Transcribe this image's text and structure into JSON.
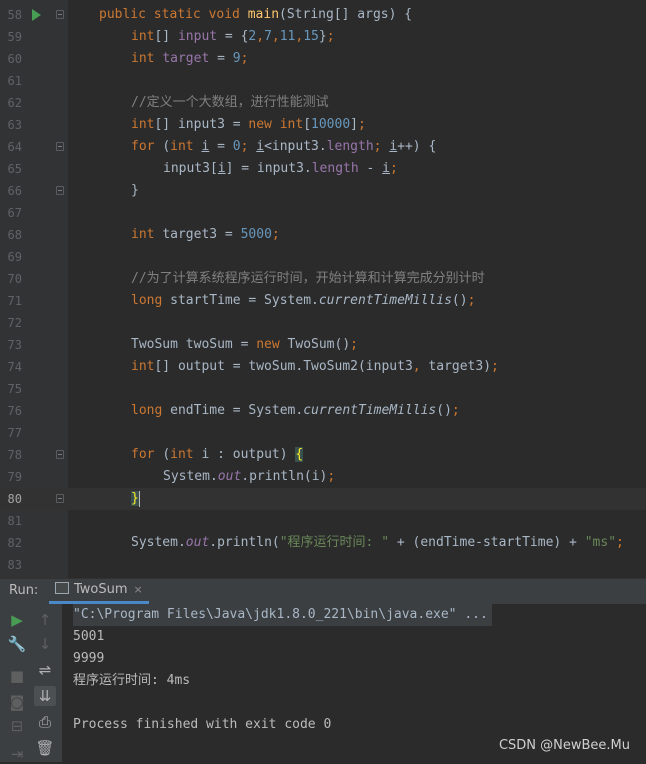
{
  "editor": {
    "current_line": "80",
    "lines": [
      {
        "num": "58",
        "fold": true,
        "run": true,
        "indent": 0,
        "tokens": [
          [
            "kw",
            "public static void "
          ],
          [
            "fn",
            "main"
          ],
          [
            "",
            "(String[] args) {"
          ]
        ]
      },
      {
        "num": "59",
        "fold": false,
        "indent": 1,
        "tokens": [
          [
            "kw",
            "int"
          ],
          [
            "",
            "[] "
          ],
          [
            "field",
            "input"
          ],
          [
            "",
            " = {"
          ],
          [
            "num",
            "2"
          ],
          [
            "kw",
            ","
          ],
          [
            "num",
            "7"
          ],
          [
            "kw",
            ","
          ],
          [
            "num",
            "11"
          ],
          [
            "kw",
            ","
          ],
          [
            "num",
            "15"
          ],
          [
            "",
            "}"
          ],
          [
            "kw",
            ";"
          ]
        ]
      },
      {
        "num": "60",
        "fold": false,
        "indent": 1,
        "tokens": [
          [
            "kw",
            "int "
          ],
          [
            "field",
            "target"
          ],
          [
            "",
            " = "
          ],
          [
            "num",
            "9"
          ],
          [
            "kw",
            ";"
          ]
        ]
      },
      {
        "num": "61",
        "fold": false,
        "indent": 0,
        "tokens": []
      },
      {
        "num": "62",
        "fold": false,
        "indent": 1,
        "tokens": [
          [
            "cmt",
            "//定义一个大数组，进行性能测试"
          ]
        ]
      },
      {
        "num": "63",
        "fold": false,
        "indent": 1,
        "tokens": [
          [
            "kw",
            "int"
          ],
          [
            "",
            "[] input3 = "
          ],
          [
            "kw",
            "new int"
          ],
          [
            "",
            "["
          ],
          [
            "num",
            "10000"
          ],
          [
            "",
            "]"
          ],
          [
            "kw",
            ";"
          ]
        ]
      },
      {
        "num": "64",
        "fold": true,
        "indent": 1,
        "tokens": [
          [
            "kw",
            "for "
          ],
          [
            "",
            "("
          ],
          [
            "kw",
            "int "
          ],
          [
            "ul",
            "i"
          ],
          [
            "",
            " = "
          ],
          [
            "num",
            "0"
          ],
          [
            "kw",
            "; "
          ],
          [
            "ul",
            "i"
          ],
          [
            "",
            "<input3."
          ],
          [
            "field",
            "length"
          ],
          [
            "kw",
            "; "
          ],
          [
            "ul",
            "i"
          ],
          [
            "",
            "++) {"
          ]
        ]
      },
      {
        "num": "65",
        "fold": false,
        "indent": 2,
        "tokens": [
          [
            "",
            "input3["
          ],
          [
            "ul",
            "i"
          ],
          [
            "",
            "] = input3."
          ],
          [
            "field",
            "length"
          ],
          [
            "",
            " - "
          ],
          [
            "ul",
            "i"
          ],
          [
            "kw",
            ";"
          ]
        ]
      },
      {
        "num": "66",
        "fold": true,
        "indent": 1,
        "tokens": [
          [
            "",
            "}"
          ]
        ]
      },
      {
        "num": "67",
        "fold": false,
        "indent": 0,
        "tokens": []
      },
      {
        "num": "68",
        "fold": false,
        "indent": 1,
        "tokens": [
          [
            "kw",
            "int "
          ],
          [
            "",
            "target3 = "
          ],
          [
            "num",
            "5000"
          ],
          [
            "kw",
            ";"
          ]
        ]
      },
      {
        "num": "69",
        "fold": false,
        "indent": 0,
        "tokens": []
      },
      {
        "num": "70",
        "fold": false,
        "indent": 1,
        "tokens": [
          [
            "cmt",
            "//为了计算系统程序运行时间，开始计算和计算完成分别计时"
          ]
        ]
      },
      {
        "num": "71",
        "fold": false,
        "indent": 1,
        "tokens": [
          [
            "kw",
            "long "
          ],
          [
            "",
            "startTime = System."
          ],
          [
            "it",
            "currentTimeMillis"
          ],
          [
            "",
            "()"
          ],
          [
            "kw",
            ";"
          ]
        ]
      },
      {
        "num": "72",
        "fold": false,
        "indent": 0,
        "tokens": []
      },
      {
        "num": "73",
        "fold": false,
        "indent": 1,
        "tokens": [
          [
            "",
            "TwoSum twoSum = "
          ],
          [
            "kw",
            "new "
          ],
          [
            "",
            "TwoSum()"
          ],
          [
            "kw",
            ";"
          ]
        ]
      },
      {
        "num": "74",
        "fold": false,
        "indent": 1,
        "tokens": [
          [
            "kw",
            "int"
          ],
          [
            "",
            "[] output = twoSum.TwoSum2(input3"
          ],
          [
            "kw",
            ", "
          ],
          [
            "",
            "target3)"
          ],
          [
            "kw",
            ";"
          ]
        ]
      },
      {
        "num": "75",
        "fold": false,
        "indent": 0,
        "tokens": []
      },
      {
        "num": "76",
        "fold": false,
        "indent": 1,
        "tokens": [
          [
            "kw",
            "long "
          ],
          [
            "",
            "endTime = System."
          ],
          [
            "it",
            "currentTimeMillis"
          ],
          [
            "",
            "()"
          ],
          [
            "kw",
            ";"
          ]
        ]
      },
      {
        "num": "77",
        "fold": false,
        "indent": 0,
        "tokens": []
      },
      {
        "num": "78",
        "fold": true,
        "indent": 1,
        "tokens": [
          [
            "kw",
            "for "
          ],
          [
            "",
            "("
          ],
          [
            "kw",
            "int "
          ],
          [
            "",
            "i : output) "
          ],
          [
            "bracehl",
            "{"
          ]
        ]
      },
      {
        "num": "79",
        "fold": false,
        "indent": 2,
        "tokens": [
          [
            "",
            "System."
          ],
          [
            "sfield",
            "out"
          ],
          [
            "",
            ".println(i)"
          ],
          [
            "kw",
            ";"
          ]
        ]
      },
      {
        "num": "80",
        "fold": true,
        "indent": 1,
        "tokens": [
          [
            "bracehl",
            "}"
          ],
          [
            "caret",
            ""
          ]
        ]
      },
      {
        "num": "81",
        "fold": false,
        "indent": 0,
        "tokens": []
      },
      {
        "num": "82",
        "fold": false,
        "indent": 1,
        "tokens": [
          [
            "",
            "System."
          ],
          [
            "sfield",
            "out"
          ],
          [
            "",
            ".println("
          ],
          [
            "str",
            "\"程序运行时间: \""
          ],
          [
            "",
            " + (endTime-startTime) + "
          ],
          [
            "str",
            "\"ms\""
          ],
          [
            ")"
          ],
          [
            "kw",
            ";"
          ]
        ]
      },
      {
        "num": "83",
        "fold": false,
        "indent": 0,
        "tokens": []
      }
    ]
  },
  "run_panel": {
    "label": "Run:",
    "tab_label": "TwoSum",
    "tab_close": "×",
    "toolbar": [
      {
        "name": "rerun-icon",
        "glyph": "▶",
        "style": "green"
      },
      {
        "name": "scroll-up-icon",
        "glyph": "↑",
        "style": "dim"
      },
      {
        "name": "wrench-icon",
        "glyph": "🔧",
        "style": ""
      },
      {
        "name": "scroll-down-icon",
        "glyph": "↓",
        "style": "dim"
      },
      {
        "name": "stop-icon",
        "glyph": "■",
        "style": "dim"
      },
      {
        "name": "soft-wrap-icon",
        "glyph": "⇌",
        "style": ""
      },
      {
        "name": "camera-icon",
        "glyph": "◙",
        "style": "dim"
      },
      {
        "name": "scroll-to-end-icon",
        "glyph": "⇊",
        "style": "sel"
      },
      {
        "name": "restore-layout-icon",
        "glyph": "⊟",
        "style": "dim"
      },
      {
        "name": "print-icon",
        "glyph": "⎙",
        "style": ""
      },
      {
        "name": "exit-icon",
        "glyph": "⇥",
        "style": "dim"
      },
      {
        "name": "trash-icon",
        "glyph": "🗑",
        "style": ""
      }
    ],
    "console_lines": [
      {
        "text": "\"C:\\Program Files\\Java\\jdk1.8.0_221\\bin\\java.exe\" ...",
        "type": "cmd"
      },
      {
        "text": "5001",
        "type": ""
      },
      {
        "text": "9999",
        "type": ""
      },
      {
        "text": "程序运行时间: 4ms",
        "type": ""
      },
      {
        "text": "",
        "type": ""
      },
      {
        "text": "Process finished with exit code 0",
        "type": ""
      }
    ]
  },
  "watermark": "CSDN @NewBee.Mu"
}
